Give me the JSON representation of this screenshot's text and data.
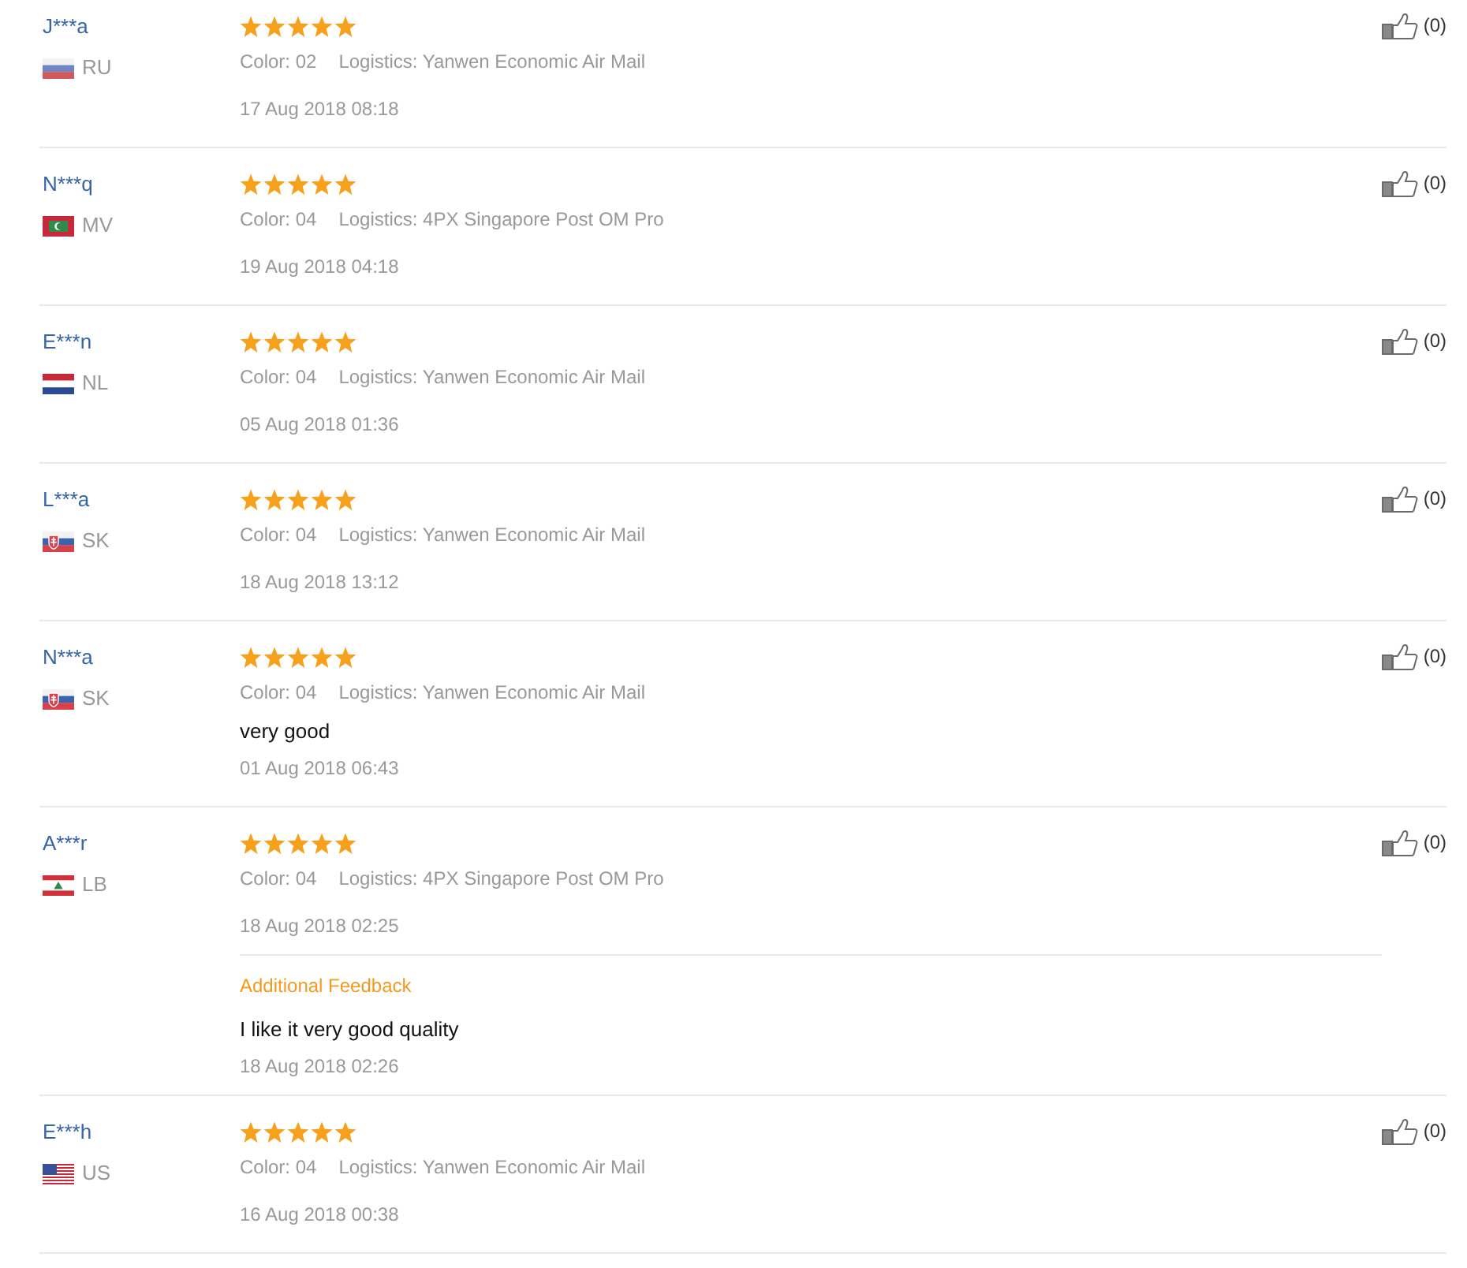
{
  "reviews": [
    {
      "name": "J***a",
      "country": {
        "kind": "russia",
        "code": "RU"
      },
      "stars": 5,
      "variant": "Color: 02",
      "logistics": "Logistics: Yanwen Economic Air Mail",
      "date": "17 Aug 2018 08:18",
      "likes": "(0)"
    },
    {
      "name": "N***q",
      "country": {
        "kind": "maldives",
        "code": "MV"
      },
      "stars": 5,
      "variant": "Color: 04",
      "logistics": "Logistics: 4PX Singapore Post OM Pro",
      "date": "19 Aug 2018 04:18",
      "likes": "(0)"
    },
    {
      "name": "E***n",
      "country": {
        "kind": "netherlands",
        "code": "NL"
      },
      "stars": 5,
      "variant": "Color: 04",
      "logistics": "Logistics: Yanwen Economic Air Mail",
      "date": "05 Aug 2018 01:36",
      "likes": "(0)"
    },
    {
      "name": "L***a",
      "country": {
        "kind": "slovakia",
        "code": "SK"
      },
      "stars": 5,
      "variant": "Color: 04",
      "logistics": "Logistics: Yanwen Economic Air Mail",
      "date": "18 Aug 2018 13:12",
      "likes": "(0)"
    },
    {
      "name": "N***a",
      "country": {
        "kind": "slovakia",
        "code": "SK"
      },
      "stars": 5,
      "variant": "Color: 04",
      "logistics": "Logistics: Yanwen Economic Air Mail",
      "comment": "very good",
      "date": "01 Aug 2018 06:43",
      "likes": "(0)"
    },
    {
      "name": "A***r",
      "country": {
        "kind": "lebanon",
        "code": "LB"
      },
      "stars": 5,
      "variant": "Color: 04",
      "logistics": "Logistics: 4PX Singapore Post OM Pro",
      "date": "18 Aug 2018 02:25",
      "likes": "(0)",
      "additional_feedback": {
        "heading": "Additional Feedback",
        "text": "I like it very good quality",
        "date": "18 Aug 2018 02:26"
      }
    },
    {
      "name": "E***h",
      "country": {
        "kind": "usa",
        "code": "US"
      },
      "stars": 5,
      "variant": "Color: 04",
      "logistics": "Logistics: Yanwen Economic Air Mail",
      "date": "16 Aug 2018 00:38",
      "likes": "(0)"
    }
  ]
}
